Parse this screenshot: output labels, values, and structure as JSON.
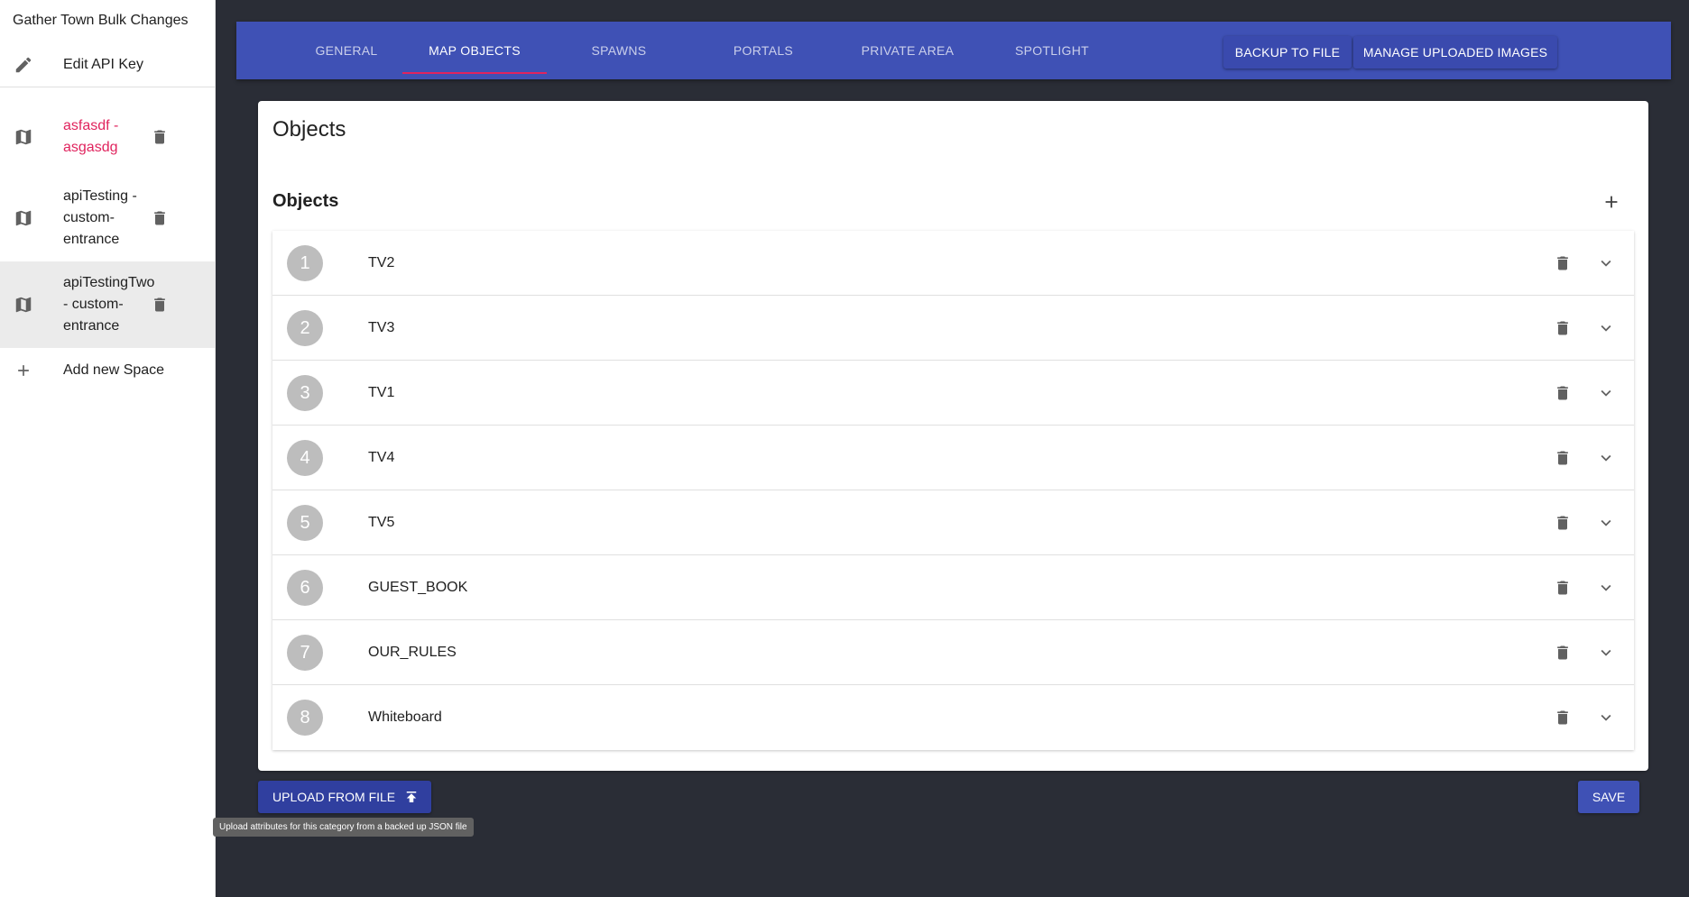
{
  "app": {
    "title": "Gather Town Bulk Changes"
  },
  "sidebar": {
    "edit_api_key": {
      "label": "Edit API Key",
      "icon": "pencil-icon"
    },
    "spaces": [
      {
        "label": "asfasdf - asgasdg",
        "icon": "map-icon",
        "delete_icon": "trash-icon",
        "active": true,
        "color": "#e0245e"
      },
      {
        "label": "apiTesting - custom-entrance",
        "icon": "map-icon",
        "delete_icon": "trash-icon",
        "active": false
      },
      {
        "label": "apiTestingTwo - custom-entrance",
        "icon": "map-icon",
        "delete_icon": "trash-icon",
        "active": false,
        "highlighted": true
      }
    ],
    "add_space": {
      "label": "Add new Space",
      "icon": "plus-icon"
    }
  },
  "topbar": {
    "color": "#3f51b5",
    "tabs": [
      {
        "label": "GENERAL",
        "active": false
      },
      {
        "label": "MAP OBJECTS",
        "active": true
      },
      {
        "label": "SPAWNS",
        "active": false
      },
      {
        "label": "PORTALS",
        "active": false
      },
      {
        "label": "PRIVATE AREA",
        "active": false
      },
      {
        "label": "SPOTLIGHT",
        "active": false
      }
    ],
    "backup_button": "BACKUP TO FILE",
    "manage_images_button": "MANAGE UPLOADED IMAGES",
    "indicator_color": "#e0245e"
  },
  "card": {
    "title": "Objects",
    "section_title": "Objects",
    "add_icon": "plus-icon",
    "objects": [
      {
        "number": "1",
        "name": "TV2"
      },
      {
        "number": "2",
        "name": "TV3"
      },
      {
        "number": "3",
        "name": "TV1"
      },
      {
        "number": "4",
        "name": "TV4"
      },
      {
        "number": "5",
        "name": "TV5"
      },
      {
        "number": "6",
        "name": "GUEST_BOOK"
      },
      {
        "number": "7",
        "name": "OUR_RULES"
      },
      {
        "number": "8",
        "name": "Whiteboard"
      }
    ]
  },
  "actions": {
    "upload_label": "UPLOAD FROM FILE",
    "upload_icon": "upload-icon",
    "upload_tooltip": "Upload attributes for this category from a backed up JSON file",
    "save_label": "SAVE"
  }
}
